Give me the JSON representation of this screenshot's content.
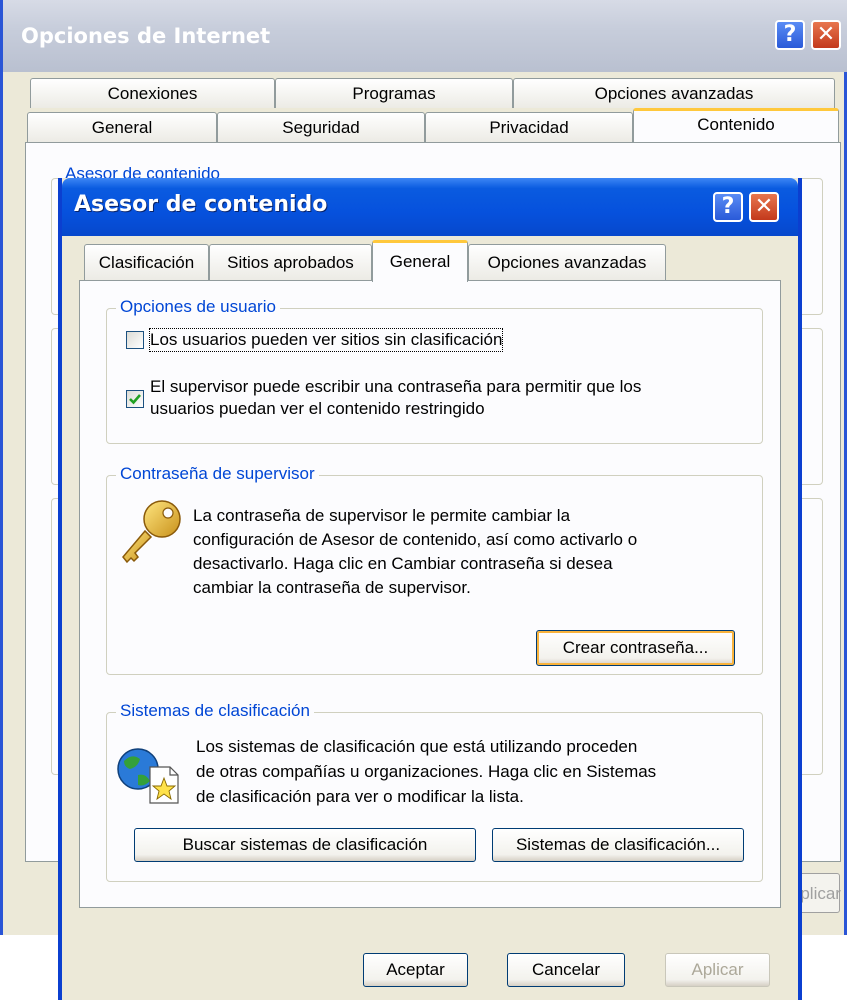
{
  "outer": {
    "title": "Opciones de Internet",
    "help_glyph": "?",
    "close_glyph": "✕",
    "tabs_row1": [
      "Conexiones",
      "Programas",
      "Opciones avanzadas"
    ],
    "tabs_row2": [
      "General",
      "Seguridad",
      "Privacidad",
      "Contenido"
    ],
    "active_tab": "Contenido",
    "partial_group_label": "Asesor de contenido",
    "partial_button": "Aplicar"
  },
  "dialog": {
    "title": "Asesor de contenido",
    "help_glyph": "?",
    "close_glyph": "✕",
    "tabs": [
      "Clasificación",
      "Sitios aprobados",
      "General",
      "Opciones avanzadas"
    ],
    "active_tab": "General",
    "user_options": {
      "label": "Opciones de usuario",
      "option1": {
        "text": "Los usuarios pueden ver sitios sin clasificación",
        "checked": false
      },
      "option2": {
        "line1": "El supervisor puede escribir una contraseña para permitir que los",
        "line2": "usuarios puedan ver el contenido restringido",
        "checked": true
      }
    },
    "supervisor": {
      "label": "Contraseña de supervisor",
      "lines": [
        "La contraseña de supervisor le permite cambiar la",
        "configuración de Asesor de contenido, así como activarlo o",
        "desactivarlo. Haga clic en Cambiar contraseña si desea",
        "cambiar la contraseña de supervisor."
      ],
      "button": "Crear contraseña..."
    },
    "rating_systems": {
      "label": "Sistemas de clasificación",
      "lines": [
        "Los sistemas de clasificación que está utilizando proceden",
        "de otras compañías u organizaciones. Haga clic en Sistemas",
        "de clasificación para ver o modificar la lista."
      ],
      "find_button": "Buscar sistemas de clasificación",
      "systems_button": "Sistemas de clasificación..."
    },
    "buttons": {
      "ok": "Aceptar",
      "cancel": "Cancelar",
      "apply": "Aplicar"
    },
    "colors": {
      "titlebar": "#0651dd",
      "group_label": "#0046d5",
      "tab_highlight": "#ffc83c"
    }
  }
}
